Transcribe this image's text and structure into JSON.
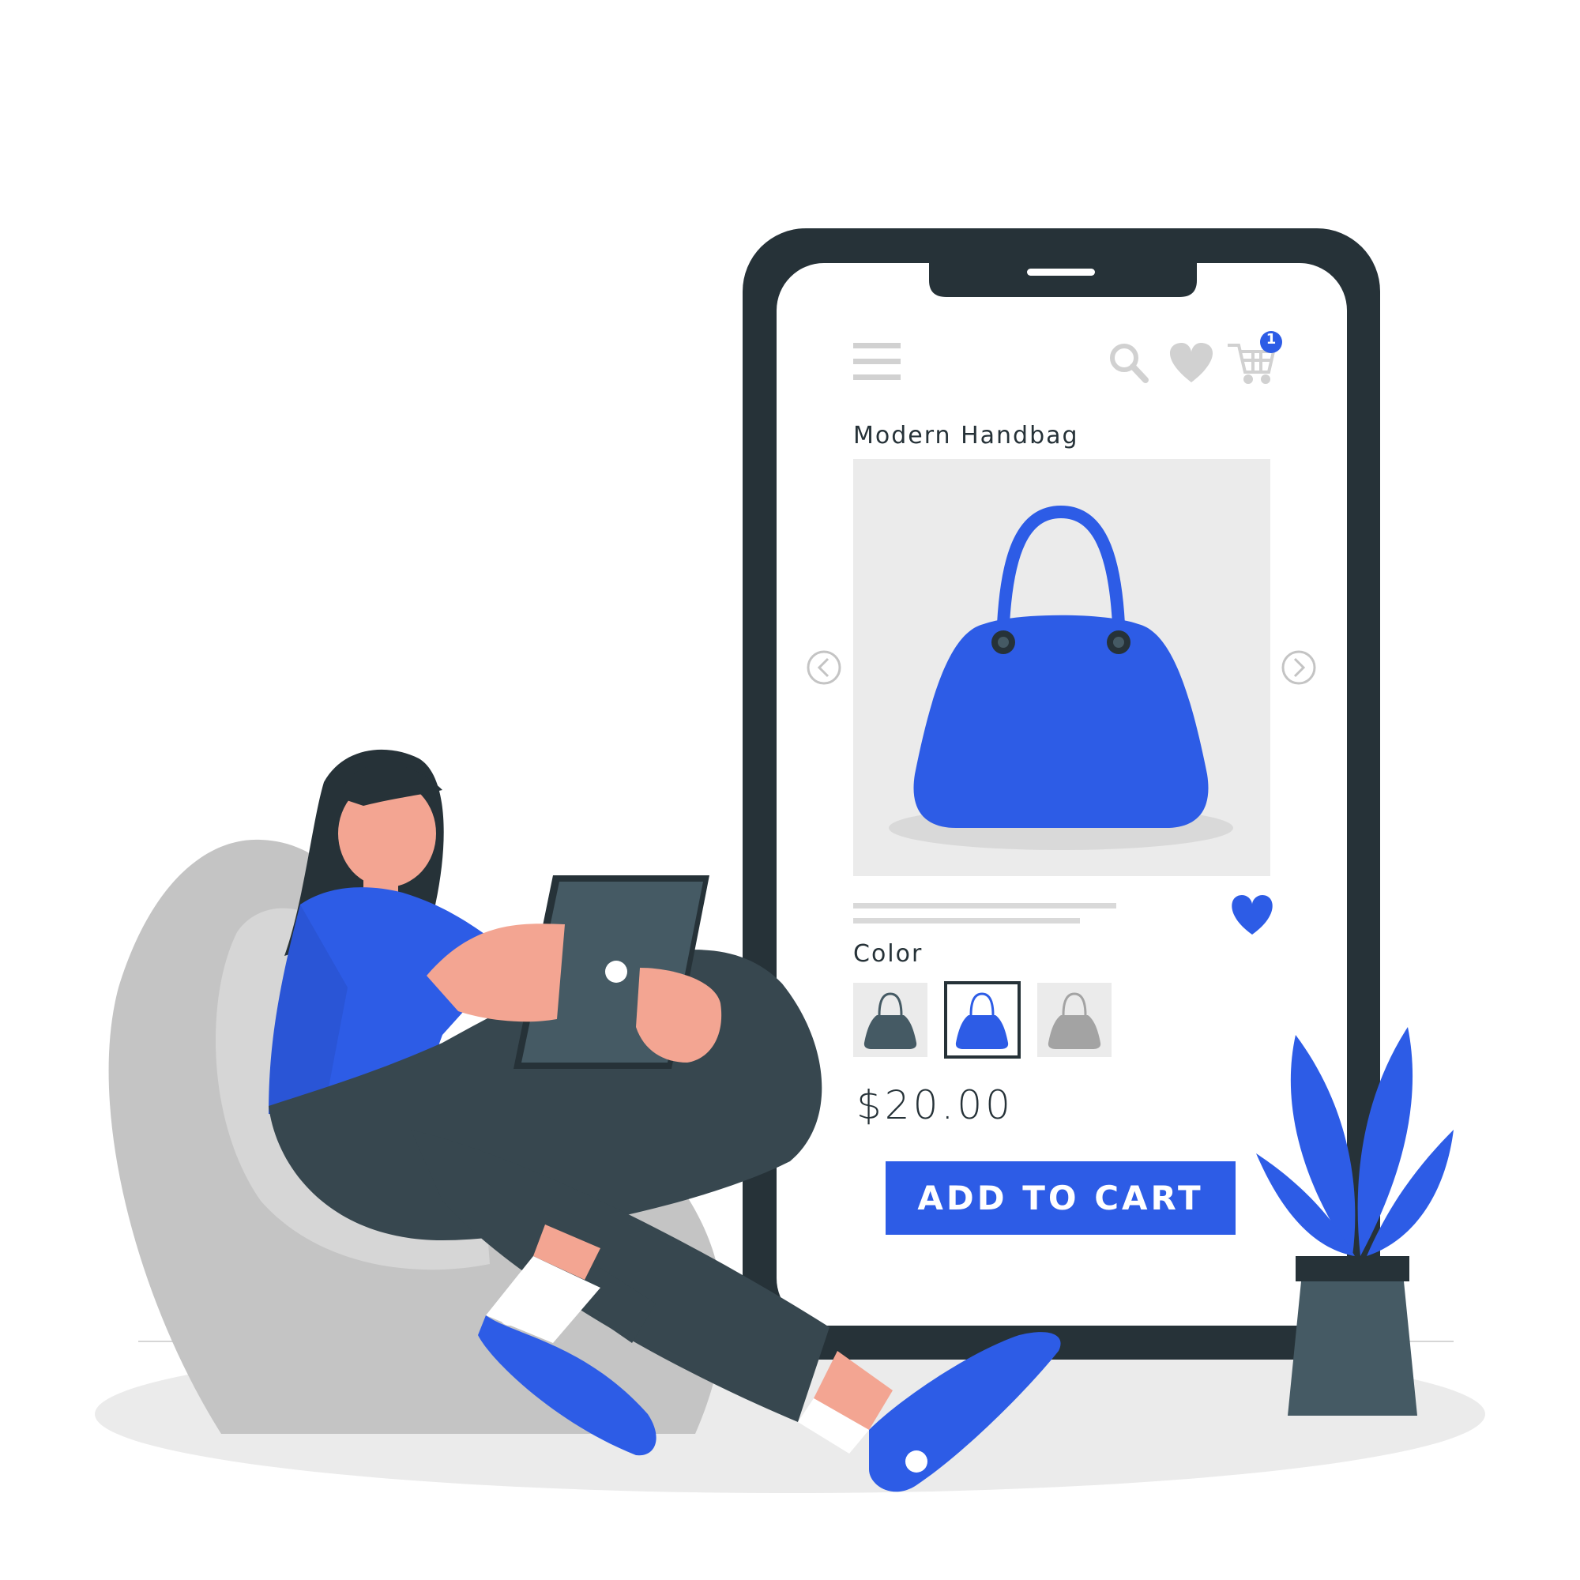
{
  "product": {
    "title": "Modern Handbag",
    "color_label": "Color",
    "price": "$20.00",
    "add_to_cart_label": "ADD TO CART",
    "colors": [
      "dark-gray",
      "blue",
      "gray"
    ],
    "selected_color": "blue"
  },
  "header": {
    "cart_count": "1"
  },
  "icons": {
    "menu": "hamburger-menu-icon",
    "search": "search-icon",
    "wishlist": "heart-icon",
    "cart": "cart-icon",
    "prev": "chevron-left-icon",
    "next": "chevron-right-icon"
  },
  "theme": {
    "accent": "#2d5ce6",
    "dark": "#263238",
    "gray": "#c4c4c4",
    "light_gray": "#ebebeb"
  }
}
